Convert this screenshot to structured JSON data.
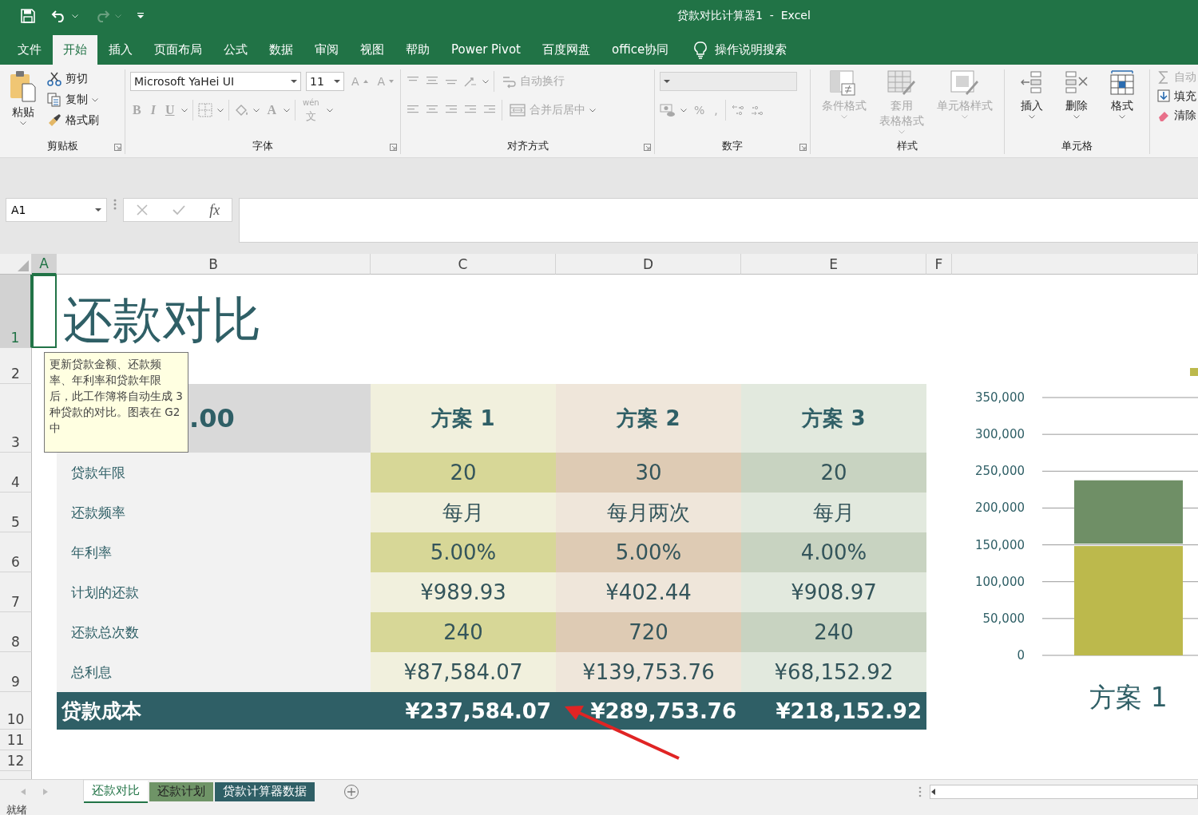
{
  "window": {
    "title": "贷款对比计算器1  -  Excel"
  },
  "ribbon_tabs": [
    {
      "label": "文件",
      "selected": false
    },
    {
      "label": "开始",
      "selected": true
    },
    {
      "label": "插入",
      "selected": false
    },
    {
      "label": "页面布局",
      "selected": false
    },
    {
      "label": "公式",
      "selected": false
    },
    {
      "label": "数据",
      "selected": false
    },
    {
      "label": "审阅",
      "selected": false
    },
    {
      "label": "视图",
      "selected": false
    },
    {
      "label": "帮助",
      "selected": false
    },
    {
      "label": "Power Pivot",
      "selected": false
    },
    {
      "label": "百度网盘",
      "selected": false
    },
    {
      "label": "office协同",
      "selected": false
    }
  ],
  "tell_me": {
    "label": "操作说明搜索"
  },
  "ribbon": {
    "clipboard": {
      "label": "剪贴板",
      "paste": "粘贴",
      "cut": "剪切",
      "copy": "复制",
      "format_painter": "格式刷"
    },
    "font": {
      "label": "字体",
      "font_name": "Microsoft YaHei UI",
      "font_size": "11",
      "grow": "A",
      "shrink": "A",
      "bold": "B",
      "italic": "I",
      "underline": "U",
      "font_color": "A",
      "phonetic": "文",
      "phonetic_reading": "wén",
      "disabled": true
    },
    "alignment": {
      "label": "对齐方式",
      "wrap_text": "自动换行",
      "merge_center": "合并后居中",
      "disabled": true
    },
    "number": {
      "label": "数字",
      "percent": "%",
      "comma": ",",
      "disabled": true
    },
    "styles": {
      "label": "样式",
      "items": [
        {
          "label": "条件格式"
        },
        {
          "label": "套用",
          "label_2": "表格格式"
        },
        {
          "label": "单元格样式"
        }
      ],
      "disabled": true
    },
    "cells": {
      "label": "单元格",
      "items": [
        "插入",
        "删除",
        "格式"
      ]
    },
    "editing": {
      "items": [
        {
          "label": "自动",
          "disabled": true
        },
        {
          "label": "填充",
          "disabled": false
        },
        {
          "label": "清除",
          "disabled": false
        }
      ]
    }
  },
  "formula_bar": {
    "name_box": "A1",
    "function_label": "fx"
  },
  "sheet": {
    "columns": [
      {
        "label": "A",
        "selected": true
      },
      {
        "label": "B",
        "selected": false
      },
      {
        "label": "C",
        "selected": false
      },
      {
        "label": "D",
        "selected": false
      },
      {
        "label": "E",
        "selected": false
      },
      {
        "label": "F",
        "selected": false
      }
    ],
    "rows": [
      {
        "label": "1",
        "selected": true
      },
      {
        "label": "2",
        "selected": false
      },
      {
        "label": "3",
        "selected": false
      },
      {
        "label": "4",
        "selected": false
      },
      {
        "label": "5",
        "selected": false
      },
      {
        "label": "6",
        "selected": false
      },
      {
        "label": "7",
        "selected": false
      },
      {
        "label": "8",
        "selected": false
      },
      {
        "label": "9",
        "selected": false
      },
      {
        "label": "10",
        "selected": false
      },
      {
        "label": "11",
        "selected": false
      },
      {
        "label": "12",
        "selected": false
      }
    ],
    "title": "还款对比",
    "amount_fragment": ".00",
    "plans": [
      "方案 1",
      "方案 2",
      "方案 3"
    ],
    "table_rows": [
      {
        "label": "贷款年限",
        "values": [
          "20",
          "30",
          "20"
        ]
      },
      {
        "label": "还款频率",
        "values": [
          "每月",
          "每月两次",
          "每月"
        ]
      },
      {
        "label": "年利率",
        "values": [
          "5.00%",
          "5.00%",
          "4.00%"
        ]
      },
      {
        "label": "计划的还款",
        "values": [
          "¥989.93",
          "¥402.44",
          "¥908.97"
        ]
      },
      {
        "label": "还款总次数",
        "values": [
          "240",
          "720",
          "240"
        ]
      },
      {
        "label": "总利息",
        "values": [
          "¥87,584.07",
          "¥139,753.76",
          "¥68,152.92"
        ]
      }
    ],
    "total": {
      "label": "贷款成本",
      "values": [
        "¥237,584.07",
        "¥289,753.76",
        "¥218,152.92"
      ]
    },
    "comment": "更新贷款金额、还款频率、年利率和贷款年限后，此工作簿将自动生成 3 种贷款的对比。图表在 G2 中",
    "chart_data": {
      "type": "bar",
      "stacked": true,
      "grid": true,
      "categories": [
        "方案 1"
      ],
      "series": [
        {
          "color": "#bcb94c",
          "values": [
            150000
          ]
        },
        {
          "color": "#6f8f66",
          "values": [
            87600
          ]
        }
      ],
      "ylim": [
        0,
        350000
      ],
      "yticks": [
        0,
        {
          "value": 50000,
          "label": "50,000"
        },
        {
          "value": 100000,
          "label": "100,000"
        },
        {
          "value": 150000,
          "label": "150,000"
        },
        {
          "value": 200000,
          "label": "200,000"
        },
        {
          "value": 250000,
          "label": "250,000"
        },
        {
          "value": 300000,
          "label": "300,000"
        },
        {
          "value": 350000,
          "label": "350,000"
        }
      ]
    }
  },
  "sheet_tabs": [
    {
      "label": "还款对比",
      "selected": true
    },
    {
      "label": "还款计划",
      "selected": false,
      "color": "#6f9467"
    },
    {
      "label": "贷款计算器数据",
      "selected": false,
      "color": "#2f5f66"
    }
  ],
  "status_bar": {
    "text": "就绪"
  }
}
